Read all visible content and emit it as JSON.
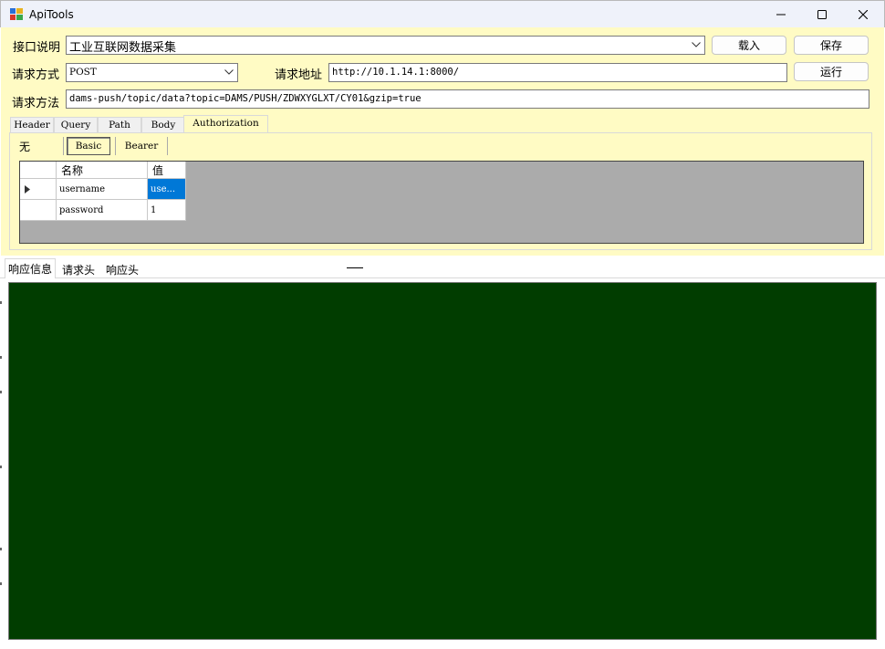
{
  "window": {
    "title": "ApiTools",
    "controls": {
      "minimize": "minimize-icon",
      "maximize": "maximize-icon",
      "close": "close-icon"
    }
  },
  "form": {
    "desc_label": "接口说明",
    "desc_value": "工业互联网数据采集",
    "method_label": "请求方式",
    "method_value": "POST",
    "url_label": "请求地址",
    "url_value": "http://10.1.14.1:8000/",
    "path_label": "请求方法",
    "path_value": "dams-push/topic/data?topic=DAMS/PUSH/ZDWXYGLXT/CY01&gzip=true",
    "load_button": "载入",
    "save_button": "保存",
    "run_button": "运行"
  },
  "request_tabs": [
    "Header",
    "Query",
    "Path",
    "Body",
    "Authorization"
  ],
  "active_request_tab": "Authorization",
  "auth": {
    "options": [
      "无",
      "Basic",
      "Bearer"
    ],
    "selected": "Basic",
    "grid": {
      "columns": [
        "名称",
        "值"
      ],
      "rows": [
        {
          "name": "username",
          "value": "use..."
        },
        {
          "name": "password",
          "value": "1"
        }
      ]
    }
  },
  "response_tabs": [
    "响应信息",
    "请求头",
    "响应头"
  ],
  "active_response_tab": "响应信息",
  "colors": {
    "form_bg": "#fffbc4",
    "response_bg": "#013d00",
    "selection": "#0078d7",
    "titlebar": "#eff2fa"
  }
}
